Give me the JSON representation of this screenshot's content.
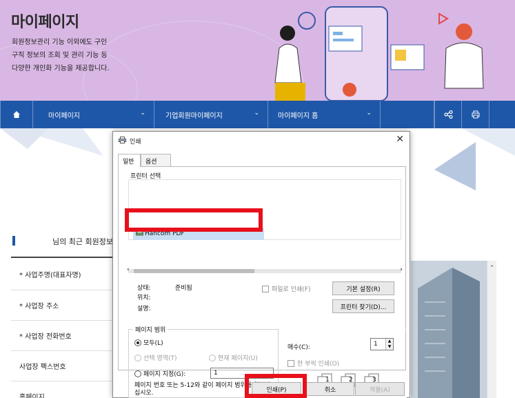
{
  "banner": {
    "title": "마이페이지",
    "desc": [
      "회원정보관리 기능 이외에도 구인",
      "구직 정보의 조회 및 관리 기능 등",
      "다양한 개인화 기능을 제공합니다."
    ]
  },
  "nav": {
    "home_icon": "home-icon",
    "menu1": "마이페이지",
    "menu2": "기업회원마이페이지",
    "menu3": "마이페이지 홈",
    "share_icon": "share-icon",
    "print_icon": "print-icon"
  },
  "section": {
    "title": "님의 최근 회원정보."
  },
  "form": {
    "rows": [
      "* 사업주명(대표자명)",
      "* 사업장 주소",
      "* 사업장 전화번호",
      "사업장 팩스번호",
      "홈페이지"
    ]
  },
  "dialog": {
    "title": "인쇄",
    "tabs": [
      "일반",
      "옵션"
    ],
    "printer_group": "프린터 선택",
    "printer_name": "Hancom PDF",
    "status_label": "상태:",
    "status_value": "준비됨",
    "location_label": "위치:",
    "comment_label": "설명:",
    "print_to_file": "파일로 인쇄(F)",
    "preferences": "기본 설정(R)",
    "find_printer": "프린터 찾기(D)...",
    "range_group": "페이지 범위",
    "range_all": "모두(L)",
    "range_selection": "선택 영역(T)",
    "range_current": "현재 페이지(U)",
    "range_pages": "페이지 지정(G):",
    "pages_value": "1",
    "hint": "페이지 번호 또는 5-12와 같이 페이지 범위를 입력하십시오.",
    "copies_label": "매수(C):",
    "copies_value": "1",
    "collate": "한 부씩 인쇄(O)",
    "collate_pages": [
      "1",
      "1",
      "2",
      "2",
      "3",
      "3"
    ],
    "btn_print": "인쇄(P)",
    "btn_cancel": "취소",
    "btn_apply": "적용(A)",
    "close_icon": "close-icon"
  },
  "colors": {
    "banner_bg": "#d9b7e4",
    "nav_bg": "#1f57a8",
    "highlight": "#e8101b",
    "selected_printer": "#c9def3"
  }
}
